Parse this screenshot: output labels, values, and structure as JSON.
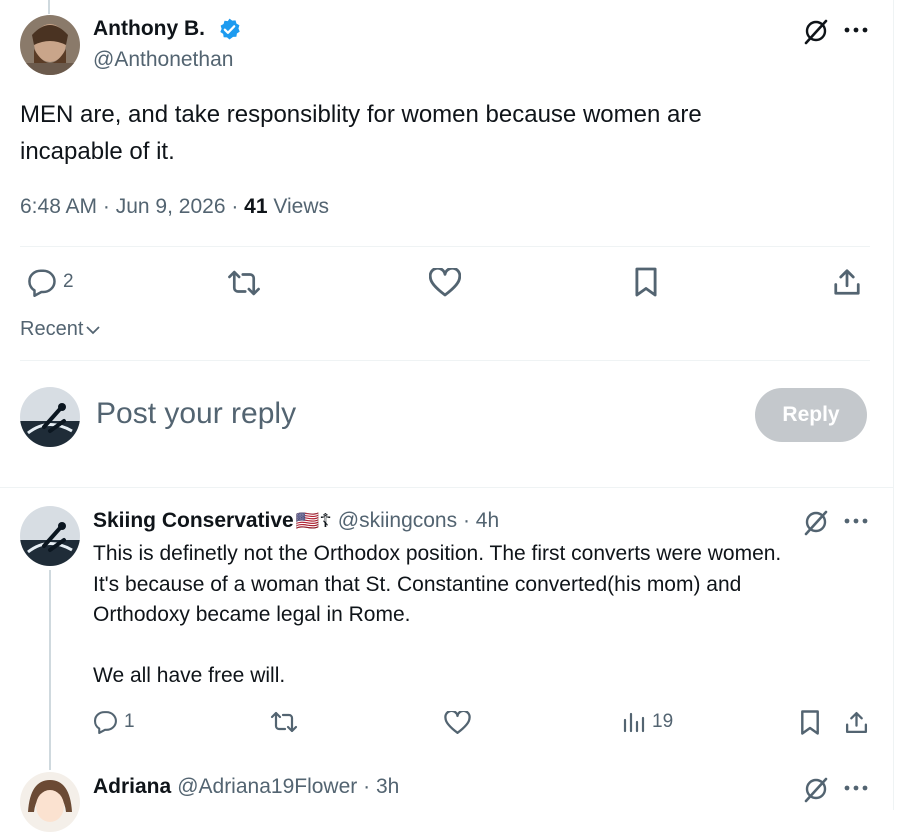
{
  "main_tweet": {
    "author_name": "Anthony B.",
    "author_handle": "@Anthonethan",
    "text_line1": "MEN are, and take responsiblity for women because women are",
    "text_line2": "incapable of it.",
    "time": "6:48 AM",
    "date": "Jun 9, 2026",
    "views_count": "41",
    "views_label": "Views",
    "reply_count": "2",
    "sort_label": "Recent"
  },
  "composer": {
    "placeholder": "Post your reply",
    "button_label": "Reply"
  },
  "replies": [
    {
      "author_name": "Skiing Conservative",
      "badges": "🇺🇸☦",
      "author_handle": "@skiingcons",
      "time": "4h",
      "text_lines": [
        "This is definetly not the Orthodox position.  The first converts were women.",
        "It's because of a woman that St. Constantine converted(his mom) and",
        "Orthodoxy became legal in Rome.",
        "",
        "We all have free will."
      ],
      "reply_count": "1",
      "views_count": "19"
    },
    {
      "author_name": "Adriana",
      "author_handle": "@Adriana19Flower",
      "time": "3h"
    }
  ],
  "colors": {
    "verified": "#1d9bf0",
    "text": "#0f1419",
    "muted": "#536471",
    "reply_button": "#c4c8cc"
  },
  "icons": [
    "verified-badge-icon",
    "grok-icon",
    "more-icon",
    "reply-icon",
    "retweet-icon",
    "like-icon",
    "bookmark-icon",
    "share-icon",
    "chevron-down-icon",
    "views-icon"
  ]
}
